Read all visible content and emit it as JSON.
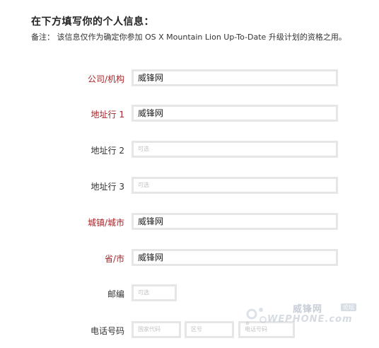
{
  "heading": "在下方填写你的个人信息：",
  "note": "备注： 该信息仅作为确定你参加 OS X Mountain Lion Up-To-Date 升级计划的资格之用。",
  "form": {
    "company": {
      "label": "公司/机构",
      "value": "威锋网"
    },
    "address1": {
      "label": "地址行 1",
      "value": "威锋网"
    },
    "address2": {
      "label": "地址行 2",
      "placeholder": "可选"
    },
    "address3": {
      "label": "地址行 3",
      "placeholder": "可选"
    },
    "city": {
      "label": "城镇/城市",
      "value": "威锋网"
    },
    "province": {
      "label": "省/市",
      "value": "威锋网"
    },
    "zip": {
      "label": "邮编",
      "placeholder": "可选"
    },
    "phone": {
      "label": "电话号码",
      "country_code_placeholder": "国家代码",
      "area_code_placeholder": "区号",
      "number_placeholder": "电话号码"
    }
  },
  "watermark": {
    "name_cn": "威锋网",
    "badge": "论坛",
    "name_en": "WEPHONE.com"
  },
  "colors": {
    "required_label": "#a3262a",
    "field_border": "#e6e6e6"
  }
}
